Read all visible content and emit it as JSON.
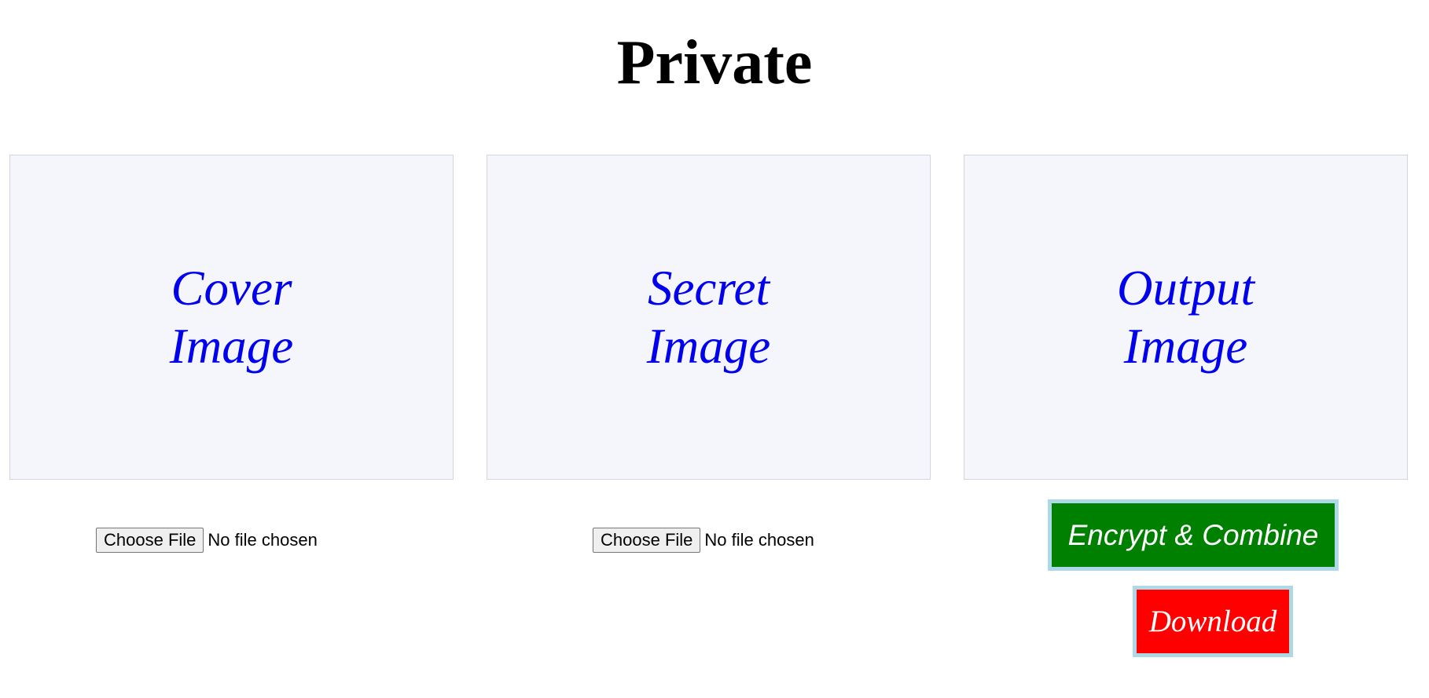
{
  "page": {
    "title": "Private"
  },
  "panels": {
    "cover": {
      "label": "Cover Image"
    },
    "secret": {
      "label": "Secret Image"
    },
    "output": {
      "label": "Output Image"
    }
  },
  "cover_file": {
    "button_label": "Choose File",
    "status": "No file chosen"
  },
  "secret_file": {
    "button_label": "Choose File",
    "status": "No file chosen"
  },
  "actions": {
    "encrypt_label": "Encrypt & Combine",
    "download_label": "Download"
  },
  "colors": {
    "panel_label": "#0000ee",
    "panel_bg": "#f5f5fc",
    "encrypt_bg": "#008000",
    "download_bg": "#ff0000",
    "action_border": "#add8e6"
  }
}
